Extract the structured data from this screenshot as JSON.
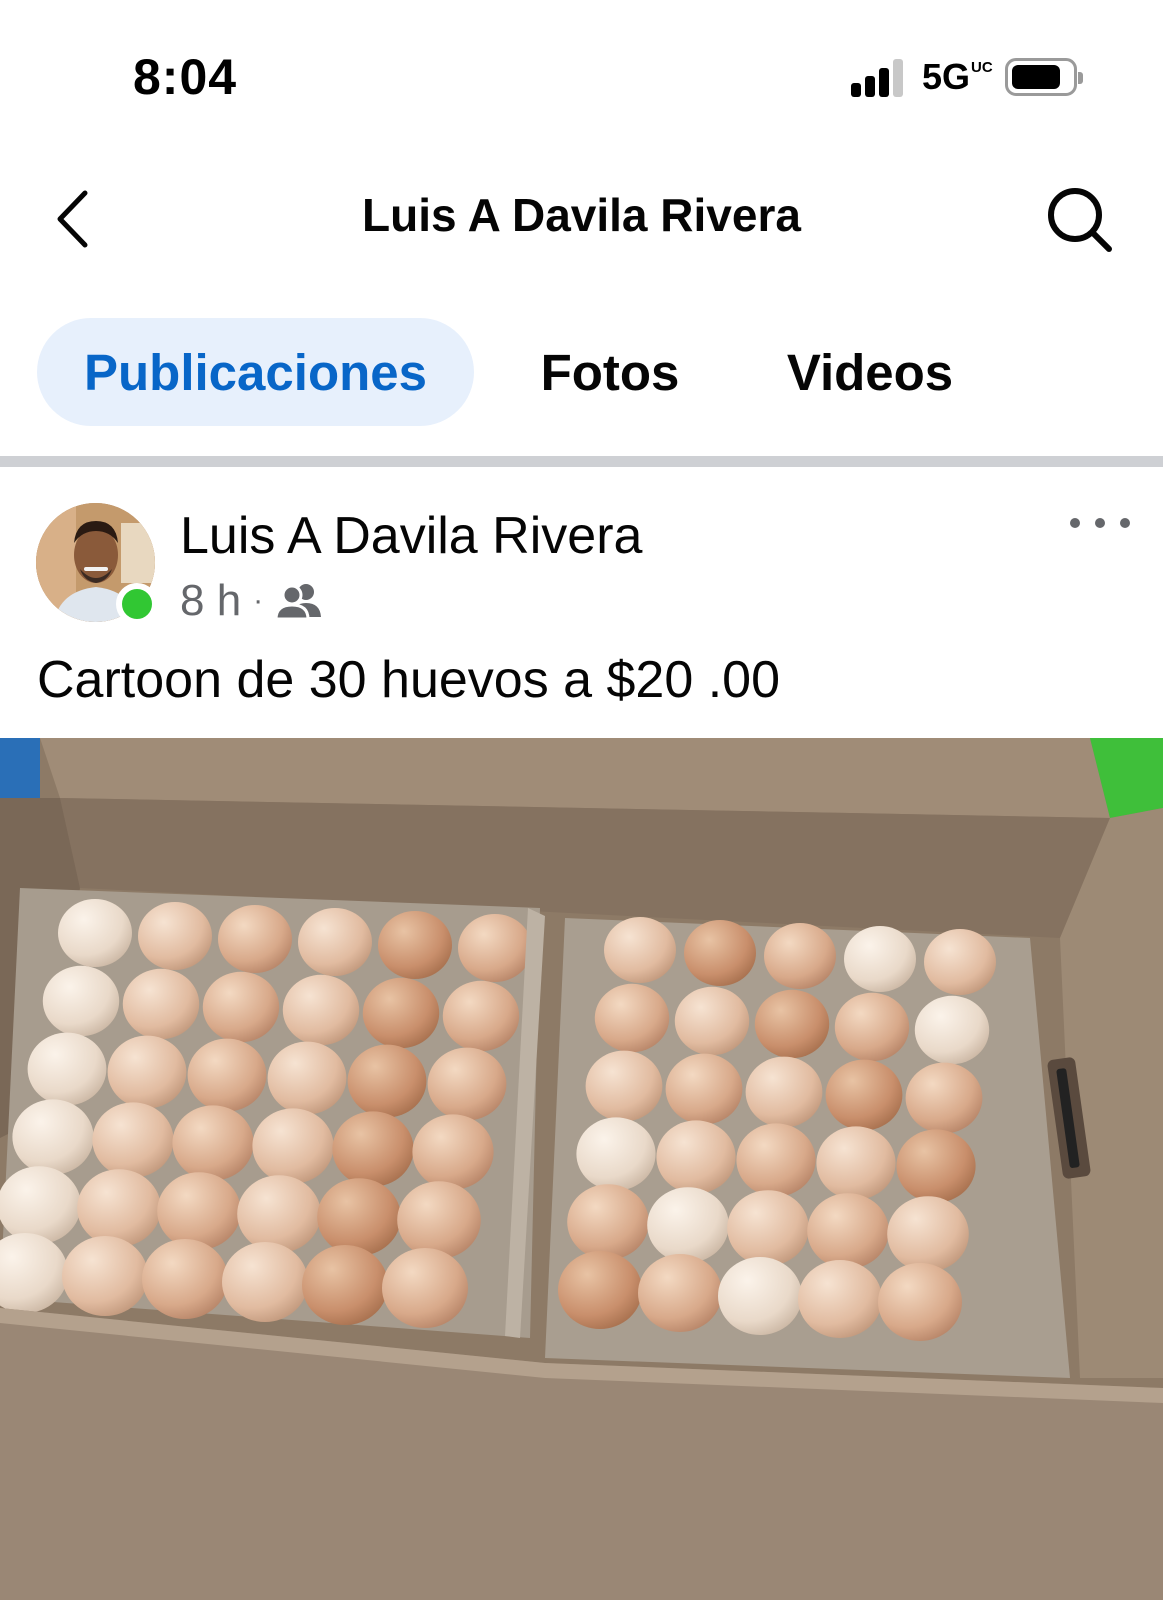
{
  "status_bar": {
    "time": "8:04",
    "network": "5G",
    "network_suffix": "UC"
  },
  "header": {
    "title": "Luis A Davila Rivera",
    "back_icon": "chevron-left-icon",
    "search_icon": "search-icon"
  },
  "tabs": [
    {
      "label": "Publicaciones",
      "active": true
    },
    {
      "label": "Fotos",
      "active": false
    },
    {
      "label": "Videos",
      "active": false
    }
  ],
  "post": {
    "author": "Luis A Davila Rivera",
    "time": "8 h",
    "separator": "·",
    "audience_icon": "friends-icon",
    "text": "Cartoon de 30 huevos a $20 .00",
    "photo": {
      "subject": "eggs-in-cardboard-box",
      "trays": 2,
      "eggs_per_tray": 30
    }
  },
  "colors": {
    "accent": "#0866c8",
    "tab_active_bg": "#e7f0fc",
    "online": "#31c733",
    "secondary_text": "#65676b",
    "divider": "#ced0d4"
  }
}
